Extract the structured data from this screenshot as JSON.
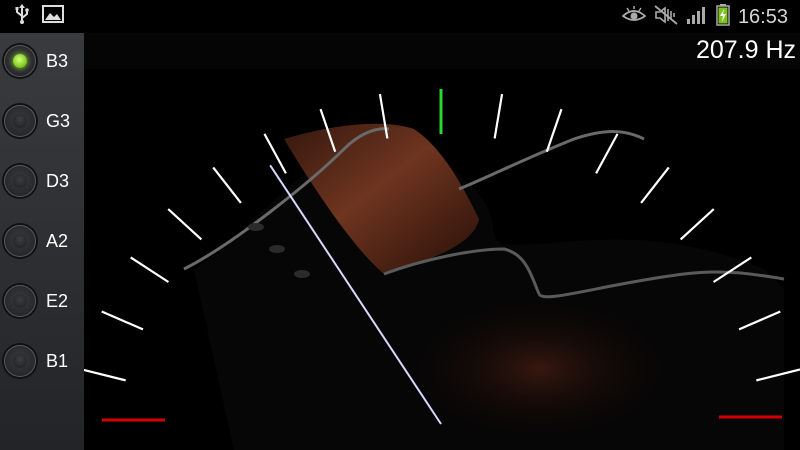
{
  "status_bar": {
    "left_icons": [
      "usb-icon",
      "image-icon"
    ],
    "right_icons": [
      "eye-icon",
      "mute-icon",
      "signal-icon",
      "battery-charging-icon"
    ],
    "time": "16:53"
  },
  "strings": [
    {
      "label": "B3",
      "active": true
    },
    {
      "label": "G3",
      "active": false
    },
    {
      "label": "D3",
      "active": false
    },
    {
      "label": "A2",
      "active": false
    },
    {
      "label": "E2",
      "active": false
    },
    {
      "label": "B1",
      "active": false
    }
  ],
  "frequency": "207.9 Hz",
  "tuner": {
    "tick_count": 17,
    "needle_level": -0.44,
    "colors": {
      "center_tick": "#2cd62c",
      "ticks": "#ffffff",
      "out_of_range": "#d40000",
      "needle": "#d8d8ff",
      "active_led": "#8ad32a"
    }
  }
}
